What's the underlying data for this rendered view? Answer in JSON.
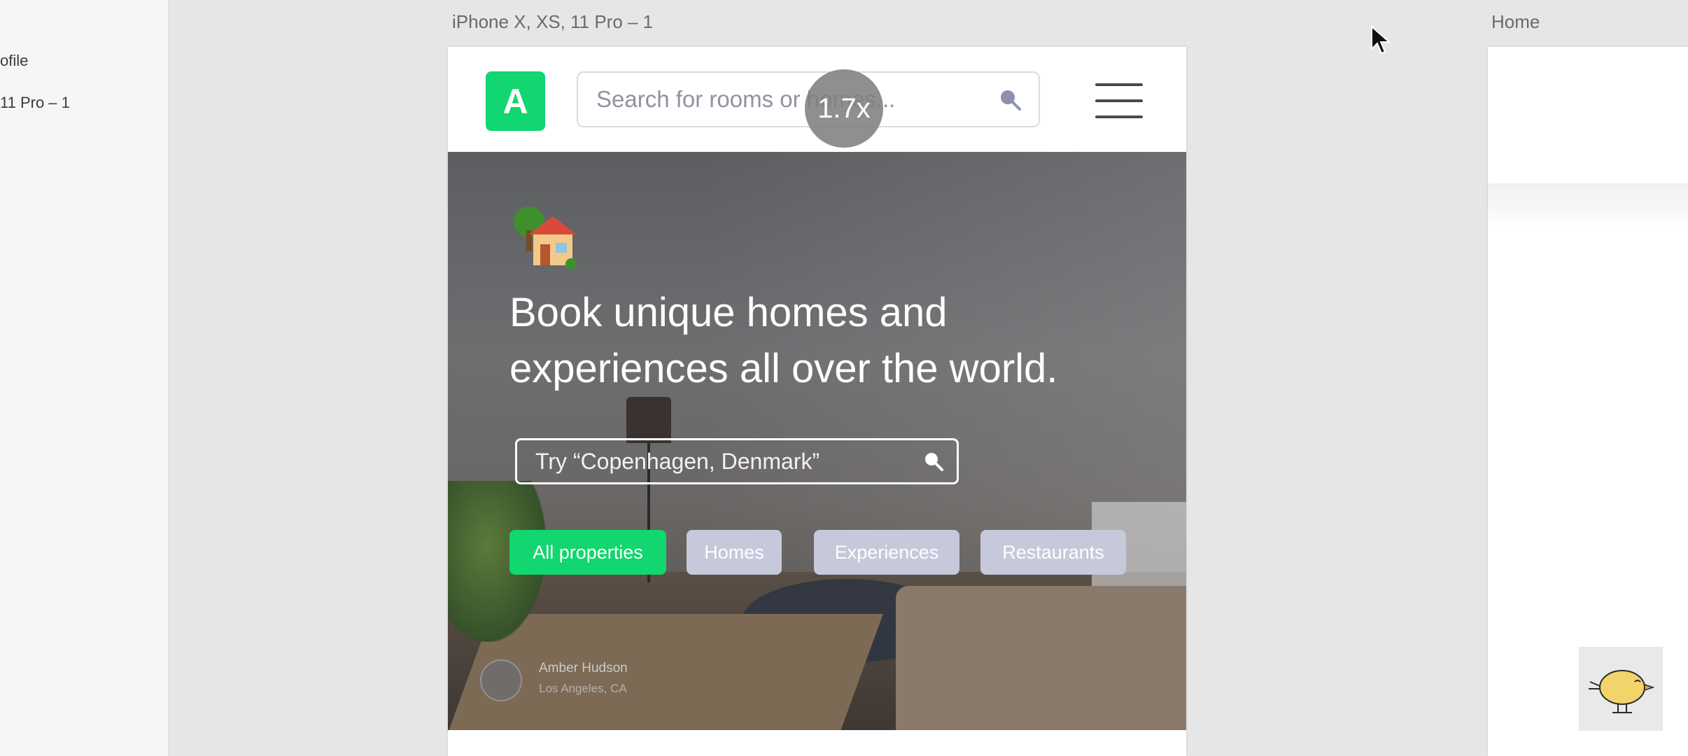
{
  "layers": {
    "items": [
      {
        "label": "ofile"
      },
      {
        "label": "11 Pro – 1"
      }
    ]
  },
  "artboards": {
    "main_label": "iPhone X, XS, 11 Pro – 1",
    "home_label": "Home"
  },
  "app": {
    "logo_letter": "A",
    "search_placeholder": "Search for rooms or homes...",
    "hero": {
      "title": "Book unique homes and\nexperiences all over the world.",
      "search_placeholder": "Try “Copenhagen, Denmark”",
      "chips": [
        {
          "label": "All properties",
          "active": true
        },
        {
          "label": "Homes",
          "active": false
        },
        {
          "label": "Experiences",
          "active": false
        },
        {
          "label": "Restaurants",
          "active": false
        }
      ],
      "photo_credit": {
        "name": "Amber Hudson",
        "location": "Los Angeles, CA"
      }
    }
  },
  "overlay": {
    "zoom": "1.7x"
  },
  "colors": {
    "brand_green": "#12d66f",
    "chip_inactive": "#c6c9da"
  },
  "icons": [
    "search-icon",
    "hamburger-menu-icon",
    "house-emoji-icon",
    "cursor-icon",
    "bird-icon"
  ]
}
